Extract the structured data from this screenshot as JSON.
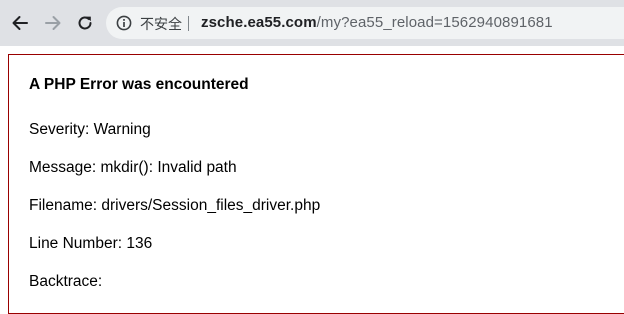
{
  "browser": {
    "security_label": "不安全",
    "url_host": "zsche.ea55.com",
    "url_path": "/my?ea55_reload=1562940891681"
  },
  "error": {
    "title": "A PHP Error was encountered",
    "severity": "Severity: Warning",
    "message": "Message: mkdir(): Invalid path",
    "filename": "Filename: drivers/Session_files_driver.php",
    "line_number": "Line Number: 136",
    "backtrace": "Backtrace:"
  },
  "colors": {
    "error_border": "#990000",
    "toolbar_bg": "#dfe1e5",
    "omnibox_bg": "#f1f3f4"
  },
  "icons": {
    "back": "arrow-left-icon",
    "forward": "arrow-right-icon",
    "reload": "reload-icon",
    "site_info": "info-icon"
  }
}
